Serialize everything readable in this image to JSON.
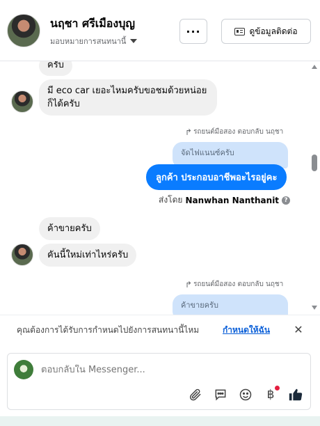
{
  "header": {
    "contact_name": "นฤชา ศรีเมืองบุญ",
    "assign_label": "มอบหมายการสนทนานี้",
    "more_label": "···",
    "contact_button_label": "ดูข้อมูลติดต่อ"
  },
  "messages": {
    "m0": "ครับ",
    "m1_line1": "มี eco car เยอะไหมครับขอชมด้วยหน่อย",
    "m1_line2": "ก็ได้ครับ",
    "reply1_meta": "รถยนต์มือสอง ตอบกลับ นฤชา",
    "reply1_ref": "จัดไฟแนนซ์ครับ",
    "out1": "ลูกค้า ประกอบอาชีพอะไรอยู่คะ",
    "sent_by_prefix": "ส่งโดย",
    "sent_by_name": "Nanwhan Nanthanit",
    "in2": "ค้าขายครับ",
    "in3": "คันนี้ใหม่เท่าไหร่ครับ",
    "reply2_meta": "รถยนต์มือสอง ตอบกลับ นฤชา",
    "reply2_ref": "ค้าขายครับ"
  },
  "assign_banner": {
    "question": "คุณต้องการได้รับการกำหนดไปยังการสนทนานี้ไหม",
    "link": "กำหนดให้ฉัน"
  },
  "composer": {
    "placeholder": "ตอบกลับใน Messenger..."
  },
  "icons": {
    "attach": "paperclip-icon",
    "saved_reply": "speech-bubble-icon",
    "emoji": "smiley-icon",
    "payment": "baht-icon",
    "like": "thumbs-up-icon"
  },
  "colors": {
    "outgoing_bubble": "#0a7cff",
    "reply_ref_bubble": "#cfe3fb",
    "incoming_bubble": "#f0f0f0",
    "link": "#0a5fd8"
  }
}
